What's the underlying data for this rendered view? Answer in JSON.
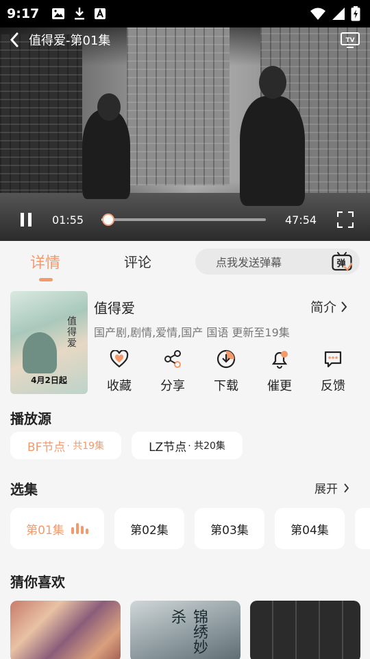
{
  "status_bar": {
    "time": "9:17"
  },
  "player": {
    "title": "值得爱-第01集",
    "current_time": "01:55",
    "total_time": "47:54",
    "progress_fraction": 0.04
  },
  "tabs": [
    {
      "label": "详情",
      "active": true
    },
    {
      "label": "评论",
      "active": false
    }
  ],
  "danmaku": {
    "placeholder": "点我发送弹幕",
    "icon_label": "弹"
  },
  "show": {
    "title": "值得爱",
    "intro_label": "简介",
    "meta": "国产剧,剧情,爱情,国产 国语 更新至19集",
    "poster_text": "值得爱",
    "poster_date": "4月2日起"
  },
  "actions": [
    {
      "label": "收藏",
      "icon": "heart-icon"
    },
    {
      "label": "分享",
      "icon": "share-icon"
    },
    {
      "label": "下载",
      "icon": "download-icon"
    },
    {
      "label": "催更",
      "icon": "bell-icon"
    },
    {
      "label": "反馈",
      "icon": "feedback-icon"
    }
  ],
  "sources": {
    "title": "播放源",
    "items": [
      {
        "name": "BF节点",
        "count": "· 共19集",
        "active": true
      },
      {
        "name": "LZ节点",
        "count": "· 共20集",
        "active": false
      }
    ]
  },
  "episodes": {
    "title": "选集",
    "expand_label": "展开",
    "items": [
      {
        "label": "第01集",
        "active": true
      },
      {
        "label": "第02集",
        "active": false
      },
      {
        "label": "第03集",
        "active": false
      },
      {
        "label": "第04集",
        "active": false
      }
    ]
  },
  "recommendations": {
    "title": "猜你喜欢",
    "items": [
      {
        "title": ""
      },
      {
        "title": "锦绣妙杀"
      },
      {
        "title": ""
      }
    ]
  },
  "colors": {
    "accent": "#f29a6c",
    "background": "#f5f5f5"
  }
}
